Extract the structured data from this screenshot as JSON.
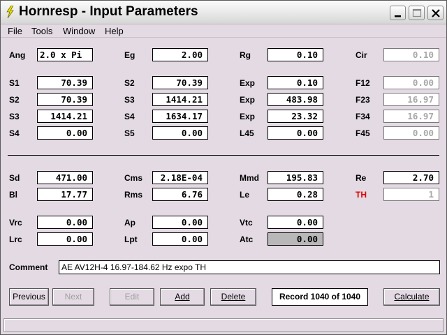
{
  "window": {
    "title": "Hornresp - Input Parameters",
    "icon": "lightning-bolt-icon"
  },
  "menu": [
    "File",
    "Tools",
    "Window",
    "Help"
  ],
  "params": {
    "ang": {
      "label": "Ang",
      "value": "2.0 x Pi"
    },
    "eg": {
      "label": "Eg",
      "value": "2.00"
    },
    "rg": {
      "label": "Rg",
      "value": "0.10"
    },
    "cir": {
      "label": "Cir",
      "value": "0.10"
    },
    "s1": {
      "label": "S1",
      "value": "70.39"
    },
    "s2a": {
      "label": "S2",
      "value": "70.39"
    },
    "exp1": {
      "label": "Exp",
      "value": "0.10"
    },
    "f12": {
      "label": "F12",
      "value": "0.00"
    },
    "s2b": {
      "label": "S2",
      "value": "70.39"
    },
    "s3a": {
      "label": "S3",
      "value": "1414.21"
    },
    "exp2": {
      "label": "Exp",
      "value": "483.98"
    },
    "f23": {
      "label": "F23",
      "value": "16.97"
    },
    "s3b": {
      "label": "S3",
      "value": "1414.21"
    },
    "s4a": {
      "label": "S4",
      "value": "1634.17"
    },
    "exp3": {
      "label": "Exp",
      "value": "23.32"
    },
    "f34": {
      "label": "F34",
      "value": "16.97"
    },
    "s4b": {
      "label": "S4",
      "value": "0.00"
    },
    "s5": {
      "label": "S5",
      "value": "0.00"
    },
    "l45": {
      "label": "L45",
      "value": "0.00"
    },
    "f45": {
      "label": "F45",
      "value": "0.00"
    },
    "sd": {
      "label": "Sd",
      "value": "471.00"
    },
    "cms": {
      "label": "Cms",
      "value": "2.18E-04"
    },
    "mmd": {
      "label": "Mmd",
      "value": "195.83"
    },
    "re": {
      "label": "Re",
      "value": "2.70"
    },
    "bl": {
      "label": "Bl",
      "value": "17.77"
    },
    "rms": {
      "label": "Rms",
      "value": "6.76"
    },
    "le": {
      "label": "Le",
      "value": "0.28"
    },
    "th": {
      "label": "TH",
      "value": "1"
    },
    "vrc": {
      "label": "Vrc",
      "value": "0.00"
    },
    "ap": {
      "label": "Ap",
      "value": "0.00"
    },
    "vtc": {
      "label": "Vtc",
      "value": "0.00"
    },
    "lrc": {
      "label": "Lrc",
      "value": "0.00"
    },
    "lpt": {
      "label": "Lpt",
      "value": "0.00"
    },
    "atc": {
      "label": "Atc",
      "value": "0.00"
    }
  },
  "comment": {
    "label": "Comment",
    "value": "AE AV12H-4 16.97-184.62 Hz expo TH"
  },
  "buttons": {
    "previous": "Previous",
    "next": "Next",
    "edit": "Edit",
    "add": "Add",
    "delete": "Delete",
    "calculate": "Calculate"
  },
  "record": "Record 1040 of 1040",
  "colors": {
    "background": "#e3dae3",
    "th_label": "#e00000",
    "disabled_text": "#a8a8a8"
  }
}
